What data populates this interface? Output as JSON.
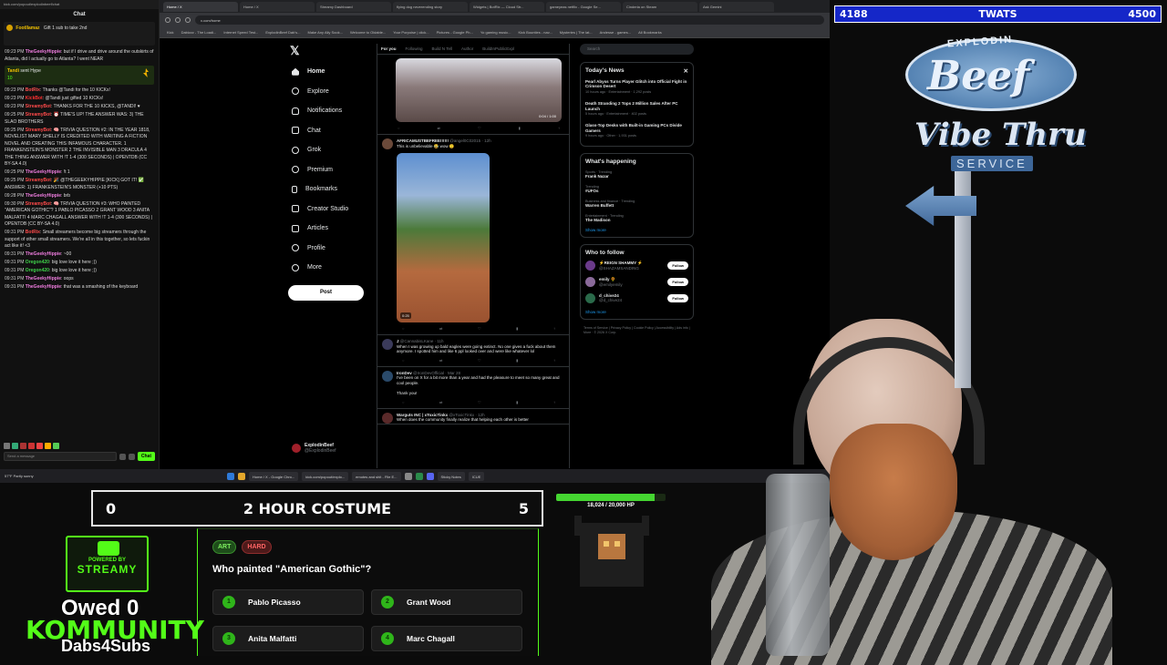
{
  "chat": {
    "header_url": "kick.com/popout/explodinbeef/chat",
    "title": "Chat",
    "pinned": {
      "user": "Footllamaz",
      "text": "Gift 1 sub to take 2nd"
    },
    "input_placeholder": "Send a message",
    "send_label": "Chat",
    "hype": {
      "user": "Tandi",
      "text": "sent Hype",
      "amount": "10"
    },
    "messages": [
      {
        "ts": "09:23 PM",
        "user": "TheGeekyHippie",
        "text": "but if I drive and drive around the outskirts of Atlanta, did I actually go to Atlanta? I went NEAR"
      },
      {
        "ts": "09:23 PM",
        "user": "BotRix",
        "text": "Thanks @Tandi for the 10 KICKs!"
      },
      {
        "ts": "09:23 PM",
        "user": "KickBot",
        "text": "@Tandi just gifted 10 KICKs!"
      },
      {
        "ts": "09:23 PM",
        "user": "StreamyBot",
        "text": "THANKS FOR THE 10 KICKS, @TANDI! ♥"
      },
      {
        "ts": "09:25 PM",
        "user": "StreamyBot",
        "text": "⏰ TIME'S UP! THE ANSWER WAS: 3) THE SLAO BROTHERS"
      },
      {
        "ts": "09:25 PM",
        "user": "StreamyBot",
        "text": "🧠 TRIVIA QUESTION #2: IN THE YEAR 1818, NOVELIST MARY SHELLY IS CREDITED WITH WRITING A FICTION NOVEL AND CREATING THIS INFAMOUS CHARACTER. 1 FRANKENSTEIN'S MONSTER 2 THE INVISIBLE MAN 3 DRACULA 4 THE THING ANSWER WITH !T 1-4 (300 SECONDS) | OPENTDB (CC BY-SA 4.0)"
      },
      {
        "ts": "09:25 PM",
        "user": "TheGeekyHippie",
        "text": "!t 1"
      },
      {
        "ts": "09:25 PM",
        "user": "StreamyBot",
        "text": "🎉 @THEGEEKYHIPPIE [KICK] GOT IT! ✅ ANSWER: 1) FRANKENSTEIN'S MONSTER (+10 PTS)"
      },
      {
        "ts": "09:28 PM",
        "user": "TheGeekyHippie",
        "text": "brb"
      },
      {
        "ts": "09:30 PM",
        "user": "StreamyBot",
        "text": "🧠 TRIVIA QUESTION #3: WHO PAINTED \"AMERICAN GOTHIC\"? 1 PABLO PICASSO 2 GRANT WOOD 3 ANITA MALFATTI 4 MARC CHAGALL ANSWER WITH !T 1-4 (300 SECONDS) | OPENTDB (CC BY-SA 4.0)"
      },
      {
        "ts": "09:31 PM",
        "user": "BotRix",
        "text": "Small streamers become big streamers through the support of other small streamers. We're all in this together, so lets fuckin act like it! <3"
      },
      {
        "ts": "09:31 PM",
        "user": "TheGeekyHippie",
        "text": "~00"
      },
      {
        "ts": "09:31 PM",
        "user": "Oregon420",
        "text": "big love love it here ;))"
      },
      {
        "ts": "09:31 PM",
        "user": "Oregon420",
        "text": "big love love it here ;))"
      },
      {
        "ts": "09:31 PM",
        "user": "TheGeekyHippie",
        "text": "oops"
      },
      {
        "ts": "09:31 PM",
        "user": "TheGeekyHippie",
        "text": "that was a smashing of the keyboard"
      }
    ]
  },
  "browser": {
    "tabs": [
      "Home / X",
      "Home / X",
      "Streamy Dashboard",
      "flying dog neverending story",
      "Widgets | BotRix — Cloud Str...",
      "gameyeas netflix - Google Se...",
      "Cinderia on Steam",
      "Ask Gemini"
    ],
    "url": "x.com/home",
    "bookmarks": [
      "Kick",
      "Dabizzz - The Loadi...",
      "Internet Speed Test...",
      "ExplodinBeef Dab's...",
      "Make Any Ally Sook...",
      "Welcome to Oldable...",
      "Your Porpoise | click...",
      "Pictures - Google Ph...",
      "Yo gaming music...",
      "Kick Bounties - nav...",
      "Mysteries | The lat...",
      "Andesse - games...",
      "All Bookmarks"
    ]
  },
  "x": {
    "nav": [
      "Home",
      "Explore",
      "Notifications",
      "Chat",
      "Grok",
      "Premium",
      "Bookmarks",
      "Creator Studio",
      "Articles",
      "Profile",
      "More"
    ],
    "nav_icons": [
      "home-icon",
      "search-icon",
      "bell-icon",
      "chat-icon",
      "grok-icon",
      "premium-icon",
      "bookmark-icon",
      "creator-studio-icon",
      "articles-icon",
      "profile-icon",
      "more-icon"
    ],
    "post_label": "Post",
    "account_name": "ExplodinBeef",
    "account_handle": "@ExplodinBeef",
    "feed_tabs": [
      "For you",
      "Following",
      "Build N Tell",
      "Author",
      "BuildInPublicExpl"
    ],
    "video1_time": "0:04 / 1:00",
    "post1": {
      "name": "AFRICAMUSTBEFREE!!!!!!",
      "handle": "@angel0C02015 · 12h",
      "text": "This is unbelievable 😂 wow 🙂",
      "duration": "0:25"
    },
    "post2": {
      "name": "J",
      "handle": "@CannabisLKane · 11h",
      "text": "When I was growing up bald eagles were going extinct. No one gives a fuck about them anymore. I spotted him and like 6 ppl looked over and were like whatever lol"
    },
    "post3": {
      "name": "IronDev",
      "handle": "@IronDevOfficial · Mar 28",
      "text": "I've been on X for a bit more than a year and had the pleasure to meet so many great and cool people.",
      "text2": "Thank you!"
    },
    "post4": {
      "name": "Warguts INC | xToxicTinkx",
      "handle": "@xToxicTinkx · 12h",
      "text": "When does the community finally realize that helping each other is better"
    },
    "search_placeholder": "Search",
    "news_title": "Today's News",
    "news": [
      {
        "title": "Pearl Abyss Turns Player Glitch into Official Fight in Crimson Desert",
        "meta": "10 hours ago · Entertainment · 1,292 posts"
      },
      {
        "title": "Death Stranding 2 Tops 2 Million Sales After PC Launch",
        "meta": "5 hours ago · Entertainment · 402 posts"
      },
      {
        "title": "Glass-Top Desks with Built-in Gaming PCs Divide Gamers",
        "meta": "9 hours ago · Other · 1,931 posts"
      }
    ],
    "happening_title": "What's happening",
    "trends": [
      {
        "cat": "Sports · Trending",
        "title": "Frank Nazar"
      },
      {
        "cat": "Trending",
        "title": "#UFOs"
      },
      {
        "cat": "Business and finance · Trending",
        "title": "Warren Buffett"
      },
      {
        "cat": "Entertainment · Trending",
        "title": "The Madison"
      }
    ],
    "show_more": "Show more",
    "wtf_title": "Who to follow",
    "follow_label": "Follow",
    "wtf": [
      {
        "name": "⚡REIGN SHAMMY ⚡",
        "handle": "@SHAZAMSANDING"
      },
      {
        "name": "emily 🌻",
        "handle": "@emilyemily"
      },
      {
        "name": "d_chive24",
        "handle": "@d_chive24"
      }
    ],
    "footer": "Terms of Service | Privacy Policy | Cookie Policy | Accessibility | Ads info | More · © 2026 X Corp."
  },
  "taskbar": {
    "weather": "57°F Partly sunny",
    "apps": [
      "Home / X - Google Chro...",
      "kick.com/popout/explo...",
      "emotes and shit - File E...",
      "Sticky Notes",
      "ICUE"
    ]
  },
  "goal": {
    "left": "4188",
    "title": "TWATS",
    "right": "4500"
  },
  "sign": {
    "explodin": "EXPLODIN",
    "beef": "Beef",
    "vibe": "Vibe Thru",
    "service": "SERVICE"
  },
  "costume": {
    "left": "0",
    "title": "2 HOUR COSTUME",
    "right": "5"
  },
  "hp": {
    "text": "18,024 / 20,000 HP",
    "fraction": 0.9012
  },
  "trivia": {
    "tags": [
      "ART",
      "HARD"
    ],
    "question": "Who painted \"American Gothic\"?",
    "options": [
      {
        "num": "1",
        "label": "Pablo Picasso"
      },
      {
        "num": "2",
        "label": "Grant Wood"
      },
      {
        "num": "3",
        "label": "Anita Malfatti"
      },
      {
        "num": "4",
        "label": "Marc Chagall"
      }
    ]
  },
  "powered": {
    "top": "POWERED BY",
    "name": "STREAMY"
  },
  "overlay": {
    "owed": "Owed 0",
    "kommunity": "KOMMUNITY",
    "dabs": "Dabs4Subs"
  }
}
